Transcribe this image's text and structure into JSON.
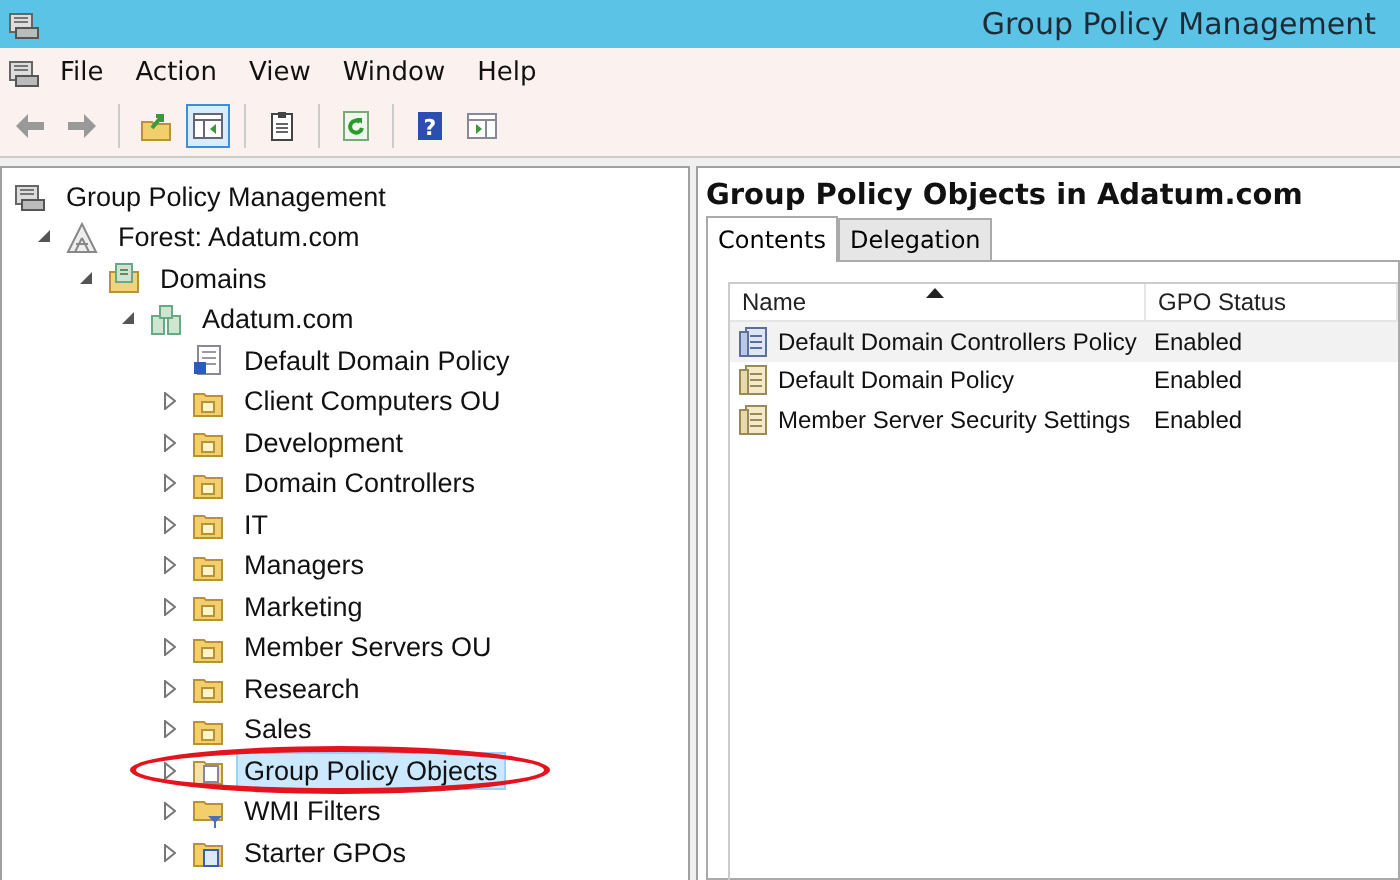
{
  "window": {
    "title": "Group Policy Management"
  },
  "menu": [
    "File",
    "Action",
    "View",
    "Window",
    "Help"
  ],
  "toolbar": [
    {
      "kind": "back",
      "pressed": false
    },
    {
      "kind": "forward",
      "pressed": false
    },
    {
      "kind": "sep"
    },
    {
      "kind": "up",
      "pressed": false
    },
    {
      "kind": "tree",
      "pressed": true
    },
    {
      "kind": "sep"
    },
    {
      "kind": "clipboard",
      "pressed": false
    },
    {
      "kind": "sep"
    },
    {
      "kind": "refresh",
      "pressed": false
    },
    {
      "kind": "sep"
    },
    {
      "kind": "help",
      "pressed": false,
      "glyph": "?"
    },
    {
      "kind": "pane",
      "pressed": false
    }
  ],
  "tree": [
    {
      "label": "Group Policy Management",
      "kind": "console",
      "selected": false,
      "children": [
        {
          "label": "Forest: Adatum.com",
          "kind": "forest",
          "expanded": true,
          "selected": false,
          "children": [
            {
              "label": "Domains",
              "kind": "domains",
              "expanded": true,
              "selected": false,
              "children": [
                {
                  "label": "Adatum.com",
                  "kind": "domain",
                  "expanded": true,
                  "selected": false,
                  "children": [
                    {
                      "label": "Default Domain Policy",
                      "kind": "link",
                      "selected": false
                    },
                    {
                      "label": "Client Computers OU",
                      "kind": "ou",
                      "expanded": false,
                      "selected": false
                    },
                    {
                      "label": "Development",
                      "kind": "ou",
                      "expanded": false,
                      "selected": false
                    },
                    {
                      "label": "Domain Controllers",
                      "kind": "ou",
                      "expanded": false,
                      "selected": false
                    },
                    {
                      "label": "IT",
                      "kind": "ou",
                      "expanded": false,
                      "selected": false
                    },
                    {
                      "label": "Managers",
                      "kind": "ou",
                      "expanded": false,
                      "selected": false
                    },
                    {
                      "label": "Marketing",
                      "kind": "ou",
                      "expanded": false,
                      "selected": false
                    },
                    {
                      "label": "Member Servers OU",
                      "kind": "ou",
                      "expanded": false,
                      "selected": false
                    },
                    {
                      "label": "Research",
                      "kind": "ou",
                      "expanded": false,
                      "selected": false
                    },
                    {
                      "label": "Sales",
                      "kind": "ou",
                      "expanded": false,
                      "selected": false
                    },
                    {
                      "label": "Group Policy Objects",
                      "kind": "gpofolder",
                      "expanded": false,
                      "selected": true,
                      "highlighted": true
                    },
                    {
                      "label": "WMI Filters",
                      "kind": "wmi",
                      "expanded": false,
                      "selected": false
                    },
                    {
                      "label": "Starter GPOs",
                      "kind": "starter",
                      "expanded": false,
                      "selected": false
                    }
                  ]
                }
              ]
            }
          ]
        }
      ]
    }
  ],
  "details": {
    "heading": "Group Policy Objects in Adatum.com",
    "tabs": [
      {
        "label": "Contents",
        "selected": true
      },
      {
        "label": "Delegation",
        "selected": false
      }
    ],
    "columns": [
      {
        "label": "Name",
        "sorted": true
      },
      {
        "label": "GPO Status",
        "sorted": false
      }
    ],
    "rows": [
      {
        "kind": "dc",
        "cells": [
          "Default Domain Controllers Policy",
          "Enabled"
        ],
        "hover": true
      },
      {
        "kind": "gpo",
        "cells": [
          "Default Domain Policy",
          "Enabled"
        ],
        "hover": false
      },
      {
        "kind": "gpo",
        "cells": [
          "Member Server Security Settings",
          "Enabled"
        ],
        "hover": false
      }
    ]
  }
}
